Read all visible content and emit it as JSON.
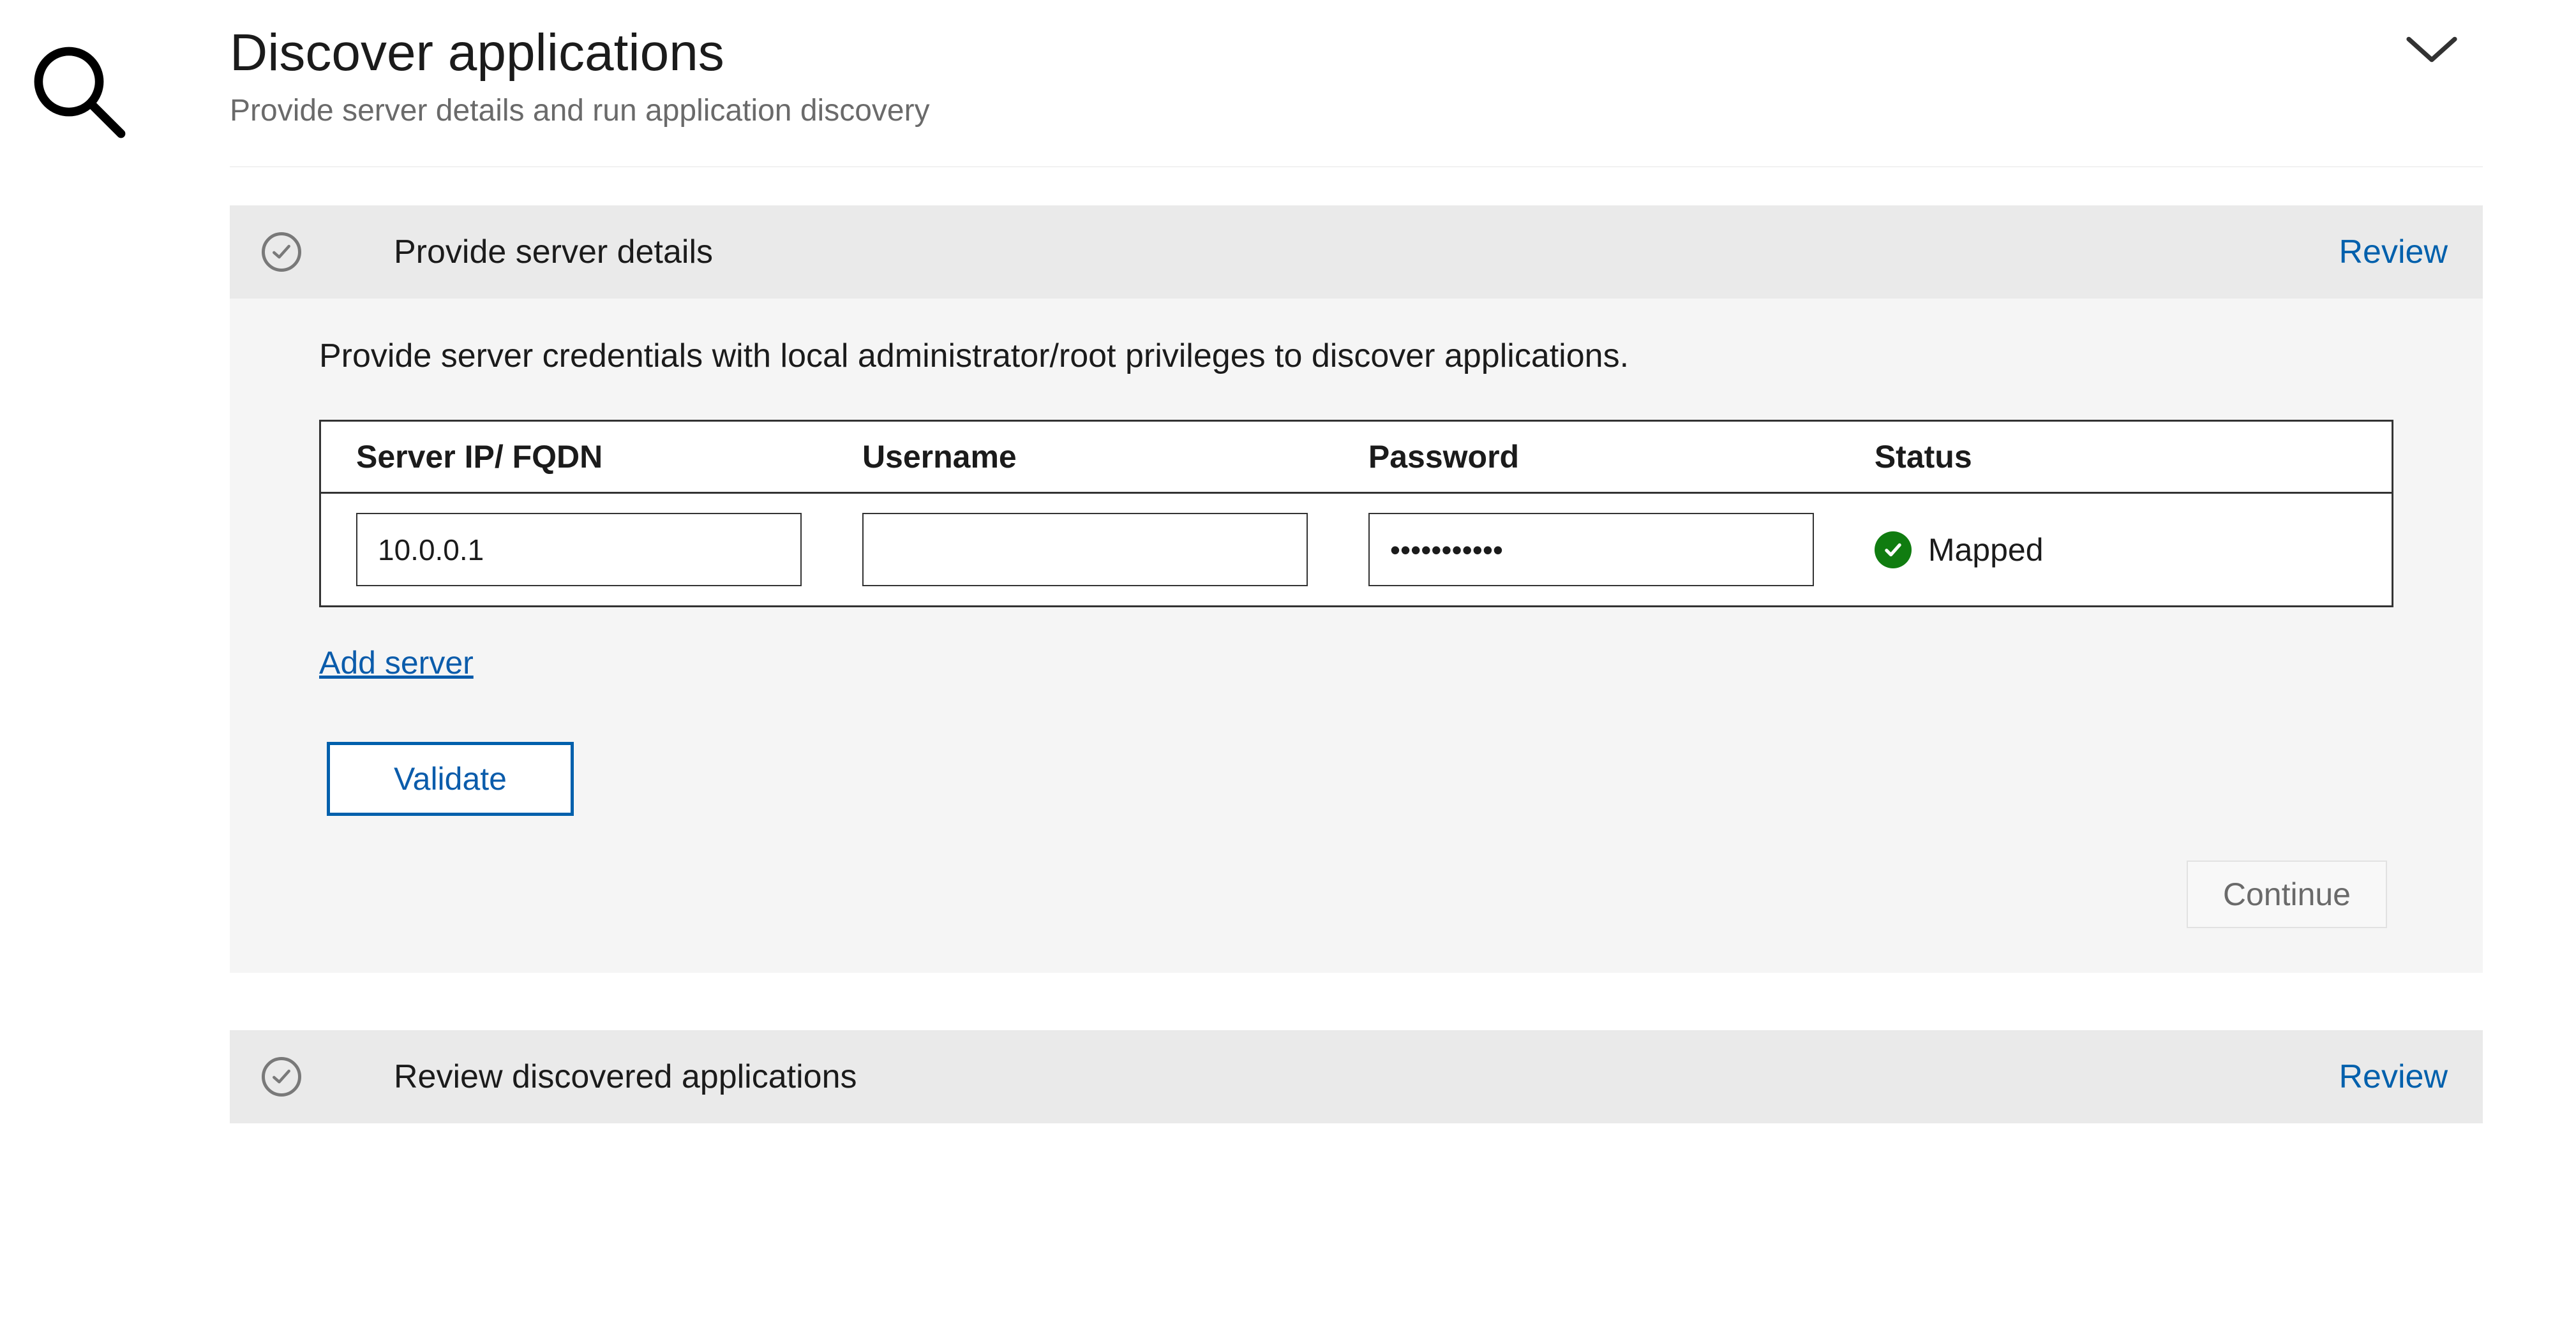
{
  "header": {
    "title": "Discover applications",
    "subtitle": "Provide server details and run application discovery"
  },
  "step1": {
    "title": "Provide server details",
    "review_label": "Review",
    "description": "Provide server credentials with local administrator/root privileges to discover applications.",
    "columns": {
      "ip": "Server IP/ FQDN",
      "username": "Username",
      "password": "Password",
      "status": "Status"
    },
    "row": {
      "ip_value": "10.0.0.1",
      "username_value": "",
      "password_value": "•••••••••••",
      "status_label": "Mapped"
    },
    "add_server_label": "Add server",
    "validate_label": "Validate",
    "continue_label": "Continue"
  },
  "step2": {
    "title": "Review discovered applications",
    "review_label": "Review"
  }
}
